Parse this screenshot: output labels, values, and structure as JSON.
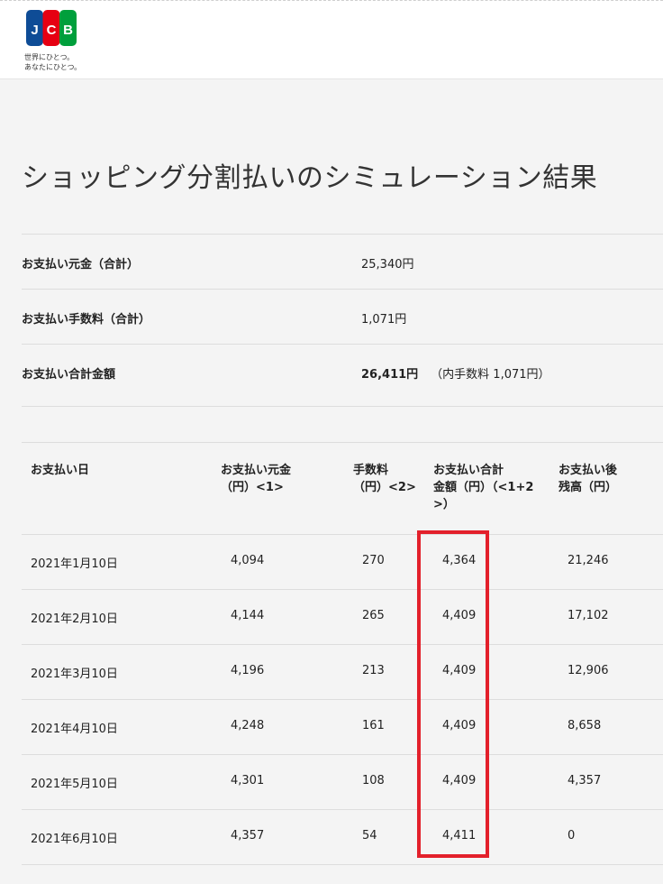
{
  "header": {
    "logo_letters": [
      "J",
      "C",
      "B"
    ],
    "tagline_line1": "世界にひとつ。",
    "tagline_line2": "あなたにひとつ。",
    "colors": {
      "logo_blue": "#0e4c96",
      "logo_red": "#e60012",
      "logo_green": "#009f3c"
    }
  },
  "page_title": "ショッピング分割払いのシミュレーション結果",
  "summary": [
    {
      "label": "お支払い元金（合計）",
      "value": "25,340円"
    },
    {
      "label": "お支払い手数料（合計）",
      "value": "1,071円"
    },
    {
      "label": "お支払い合計金額",
      "value": "26,411円",
      "note": "（内手数料 1,071円）"
    }
  ],
  "table": {
    "headers": {
      "date": "お支払い日",
      "principal_l1": "お支払い元金",
      "principal_l2": "（円）<1>",
      "fee_l1": "手数料",
      "fee_l2": "（円）<2>",
      "total_l1": "お支払い合計",
      "total_l2": "金額（円）（<1+2",
      "total_l3": ">）",
      "balance_l1": "お支払い後",
      "balance_l2": "残高（円）"
    },
    "rows": [
      {
        "date": "2021年1月10日",
        "principal": "4,094",
        "fee": "270",
        "total": "4,364",
        "balance": "21,246"
      },
      {
        "date": "2021年2月10日",
        "principal": "4,144",
        "fee": "265",
        "total": "4,409",
        "balance": "17,102"
      },
      {
        "date": "2021年3月10日",
        "principal": "4,196",
        "fee": "213",
        "total": "4,409",
        "balance": "12,906"
      },
      {
        "date": "2021年4月10日",
        "principal": "4,248",
        "fee": "161",
        "total": "4,409",
        "balance": "8,658"
      },
      {
        "date": "2021年5月10日",
        "principal": "4,301",
        "fee": "108",
        "total": "4,409",
        "balance": "4,357"
      },
      {
        "date": "2021年6月10日",
        "principal": "4,357",
        "fee": "54",
        "total": "4,411",
        "balance": "0"
      }
    ]
  },
  "highlight_color": "#e3202b"
}
